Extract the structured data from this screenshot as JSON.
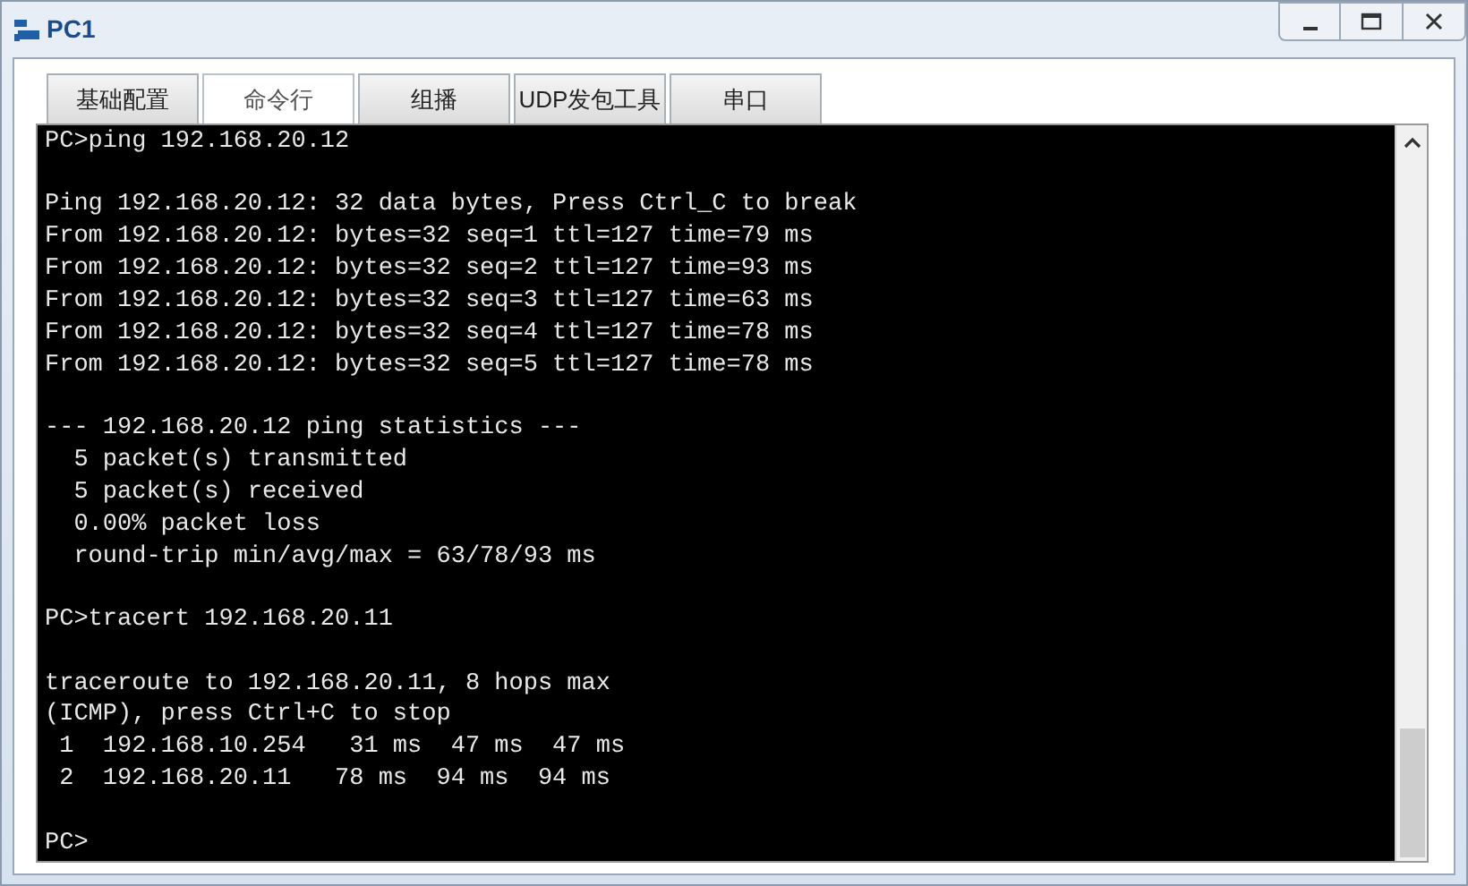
{
  "window": {
    "title": "PC1"
  },
  "tabs": [
    {
      "label": "基础配置",
      "selected": false
    },
    {
      "label": "命令行",
      "selected": true
    },
    {
      "label": "组播",
      "selected": false
    },
    {
      "label": "UDP发包工具",
      "selected": false
    },
    {
      "label": "串口",
      "selected": false
    }
  ],
  "terminal": {
    "blocks": [
      [
        "PC>ping 192.168.20.12"
      ],
      [
        "Ping 192.168.20.12: 32 data bytes, Press Ctrl_C to break",
        "From 192.168.20.12: bytes=32 seq=1 ttl=127 time=79 ms",
        "From 192.168.20.12: bytes=32 seq=2 ttl=127 time=93 ms",
        "From 192.168.20.12: bytes=32 seq=3 ttl=127 time=63 ms",
        "From 192.168.20.12: bytes=32 seq=4 ttl=127 time=78 ms",
        "From 192.168.20.12: bytes=32 seq=5 ttl=127 time=78 ms"
      ],
      [
        "--- 192.168.20.12 ping statistics ---",
        "  5 packet(s) transmitted",
        "  5 packet(s) received",
        "  0.00% packet loss",
        "  round-trip min/avg/max = 63/78/93 ms"
      ],
      [
        "PC>tracert 192.168.20.11"
      ],
      [
        "traceroute to 192.168.20.11, 8 hops max",
        "(ICMP), press Ctrl+C to stop",
        " 1  192.168.10.254   31 ms  47 ms  47 ms",
        " 2  192.168.20.11   78 ms  94 ms  94 ms"
      ],
      [
        "PC>"
      ]
    ]
  }
}
